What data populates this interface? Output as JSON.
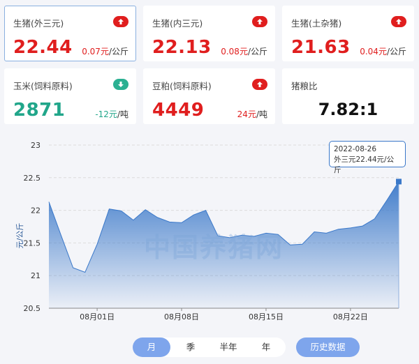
{
  "cards": [
    {
      "name": "生猪(外三元)",
      "price": "22.44",
      "change": "0.07元",
      "unit": "/公斤",
      "trend": "up"
    },
    {
      "name": "生猪(内三元)",
      "price": "22.13",
      "change": "0.08元",
      "unit": "/公斤",
      "trend": "up"
    },
    {
      "name": "生猪(土杂猪)",
      "price": "21.63",
      "change": "0.04元",
      "unit": "/公斤",
      "trend": "up"
    },
    {
      "name": "玉米(饲料原料)",
      "price": "2871",
      "change": "-12元",
      "unit": "/吨",
      "trend": "down"
    },
    {
      "name": "豆粕(饲料原料)",
      "price": "4449",
      "change": "24元",
      "unit": "/吨",
      "trend": "up"
    },
    {
      "name": "猪粮比",
      "price": "7.82:1"
    }
  ],
  "colors": {
    "up": "#e01e1e",
    "down": "#21a68a",
    "line": "#3a78c9",
    "accent": "#7ea5ec"
  },
  "tooltip": {
    "date": "2022-08-26",
    "text": "外三元22.44元/公斤"
  },
  "watermark": "中国养猪网",
  "range_buttons": [
    {
      "label": "月",
      "active": true
    },
    {
      "label": "季",
      "active": false
    },
    {
      "label": "半年",
      "active": false
    },
    {
      "label": "年",
      "active": false
    }
  ],
  "history_button": "历史数据",
  "chart_data": {
    "type": "area",
    "ylabel": "元/公斤",
    "ylim": [
      20.5,
      23
    ],
    "yticks": [
      20.5,
      21,
      21.5,
      22,
      22.5,
      23
    ],
    "xticks": [
      "08月01日",
      "08月08日",
      "08月15日",
      "08月22日"
    ],
    "grid": true,
    "x": [
      "07-28",
      "07-29",
      "07-30",
      "07-31",
      "08-01",
      "08-02",
      "08-03",
      "08-04",
      "08-05",
      "08-06",
      "08-07",
      "08-08",
      "08-09",
      "08-10",
      "08-11",
      "08-12",
      "08-13",
      "08-14",
      "08-15",
      "08-16",
      "08-17",
      "08-18",
      "08-19",
      "08-20",
      "08-21",
      "08-22",
      "08-23",
      "08-24",
      "08-25",
      "08-26"
    ],
    "series": [
      {
        "values": [
          22.13,
          21.62,
          21.12,
          21.05,
          21.48,
          22.02,
          21.99,
          21.85,
          22.01,
          21.89,
          21.82,
          21.81,
          21.93,
          22.0,
          21.61,
          21.58,
          21.62,
          21.6,
          21.65,
          21.63,
          21.47,
          21.48,
          21.67,
          21.65,
          21.71,
          21.73,
          21.76,
          21.87,
          22.15,
          22.44
        ]
      }
    ]
  }
}
